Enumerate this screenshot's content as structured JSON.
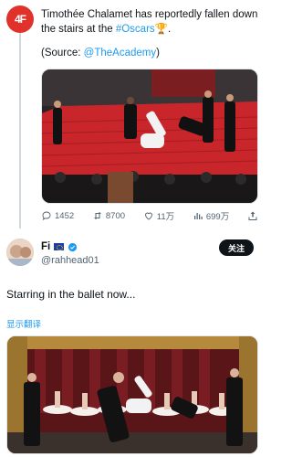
{
  "tweet": {
    "avatar_text": "4F",
    "text_main": "Timothée Chalamet has reportedly fallen down the stairs at the ",
    "hashtag": "#Oscars",
    "text_end": "🏆.",
    "source_prefix": "(Source: ",
    "source_handle": "@TheAcademy",
    "source_suffix": ")",
    "media_alt": "Red carpet stairs photo",
    "actions": {
      "reply": "1452",
      "retweet": "8700",
      "like": "11万",
      "views": "699万"
    }
  },
  "reply": {
    "name": "Fi",
    "handle": "@rahhead01",
    "follow_label": "关注",
    "text": "Starring in the ballet now...",
    "translate_label": "显示翻译",
    "media_alt": "Ballet stage photo"
  },
  "colors": {
    "link": "#1d9bf0",
    "muted": "#536471",
    "brand": "#e0312b",
    "carpet": "#c8262b"
  }
}
